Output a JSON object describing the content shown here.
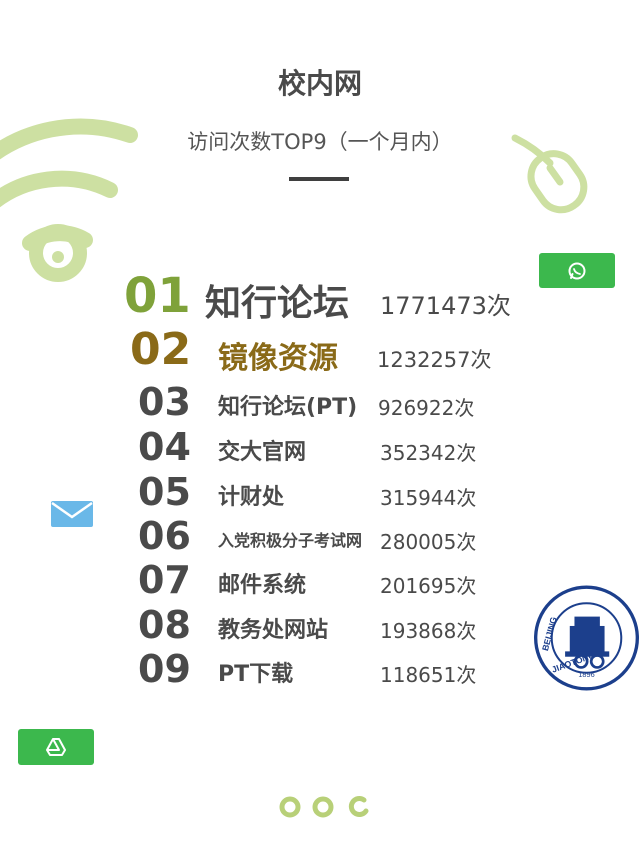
{
  "header": {
    "title": "校内网",
    "subtitle": "访问次数TOP9（一个月内）"
  },
  "ranking": [
    {
      "rank": "01",
      "name": "知行论坛",
      "count": "1771473次"
    },
    {
      "rank": "02",
      "name": "镜像资源",
      "count": "1232257次"
    },
    {
      "rank": "03",
      "name": "知行论坛(PT)",
      "count": "926922次"
    },
    {
      "rank": "04",
      "name": "交大官网",
      "count": "352342次"
    },
    {
      "rank": "05",
      "name": "计财处",
      "count": "315944次"
    },
    {
      "rank": "06",
      "name": "入党积极分子考试网",
      "count": "280005次"
    },
    {
      "rank": "07",
      "name": "邮件系统",
      "count": "201695次"
    },
    {
      "rank": "08",
      "name": "教务处网站",
      "count": "193868次"
    },
    {
      "rank": "09",
      "name": "PT下载",
      "count": "118651次"
    }
  ],
  "seal": {
    "text_left": "BEIJING",
    "text_bottom": "JIAOTONG",
    "year": "1896"
  },
  "icons": {
    "wifi": "wifi-icon",
    "mouse": "mouse-icon",
    "wechat": "wechat-icon",
    "mail": "mail-icon",
    "drive": "drive-icon",
    "pager": "pager-dots-icon",
    "seal": "university-seal-icon"
  },
  "colors": {
    "accent_green": "#a6c95a",
    "gold": "#8a6a18",
    "text": "#4a4a4a",
    "button_green": "#3cb84d",
    "seal_blue": "#1c3f8c"
  }
}
